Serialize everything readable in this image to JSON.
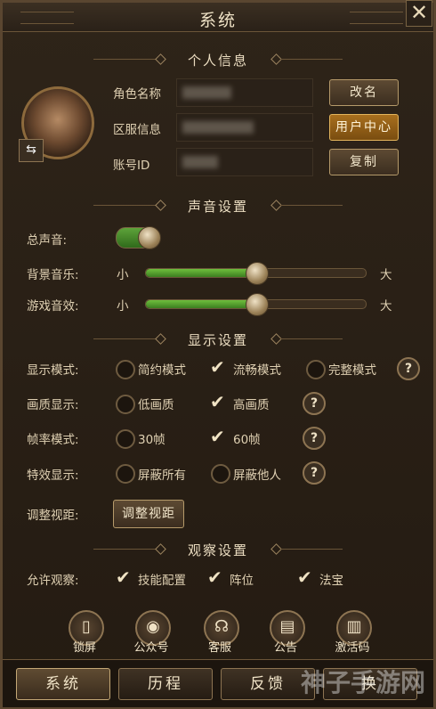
{
  "window": {
    "title": "系统"
  },
  "sections": {
    "personal": "个人信息",
    "sound": "声音设置",
    "display": "显示设置",
    "observe": "观察设置"
  },
  "personal": {
    "role_name_label": "角色名称",
    "server_label": "区服信息",
    "account_label": "账号ID",
    "rename_button": "改名",
    "user_center_button": "用户中心",
    "copy_button": "复制"
  },
  "sound": {
    "master_label": "总声音:",
    "bgm_label": "背景音乐:",
    "sfx_label": "游戏音效:",
    "min_label": "小",
    "max_label": "大",
    "master_on": true,
    "bgm_level": 0.5,
    "sfx_level": 0.5
  },
  "display": {
    "mode_label": "显示模式:",
    "mode_options": [
      "简约模式",
      "流畅模式",
      "完整模式"
    ],
    "mode_selected": "流畅模式",
    "quality_label": "画质显示:",
    "quality_options": [
      "低画质",
      "高画质"
    ],
    "quality_selected": "高画质",
    "fps_label": "帧率模式:",
    "fps_options": [
      "30帧",
      "60帧"
    ],
    "fps_selected": "60帧",
    "effects_label": "特效显示:",
    "effects_options": [
      "屏蔽所有",
      "屏蔽他人"
    ],
    "view_label": "调整视距:",
    "view_button": "调整视距"
  },
  "observe": {
    "allow_label": "允许观察:",
    "options": [
      "技能配置",
      "阵位",
      "法宝"
    ]
  },
  "quick_buttons": [
    {
      "label": "锁屏",
      "icon": "lock-phone-icon"
    },
    {
      "label": "公众号",
      "icon": "wechat-icon"
    },
    {
      "label": "客服",
      "icon": "headset-icon"
    },
    {
      "label": "公告",
      "icon": "chest-icon"
    },
    {
      "label": "激活码",
      "icon": "scroll-icon"
    }
  ],
  "tabs": [
    "系统",
    "历程",
    "反馈",
    "换"
  ],
  "active_tab": "系统",
  "watermark": "神子手游网"
}
